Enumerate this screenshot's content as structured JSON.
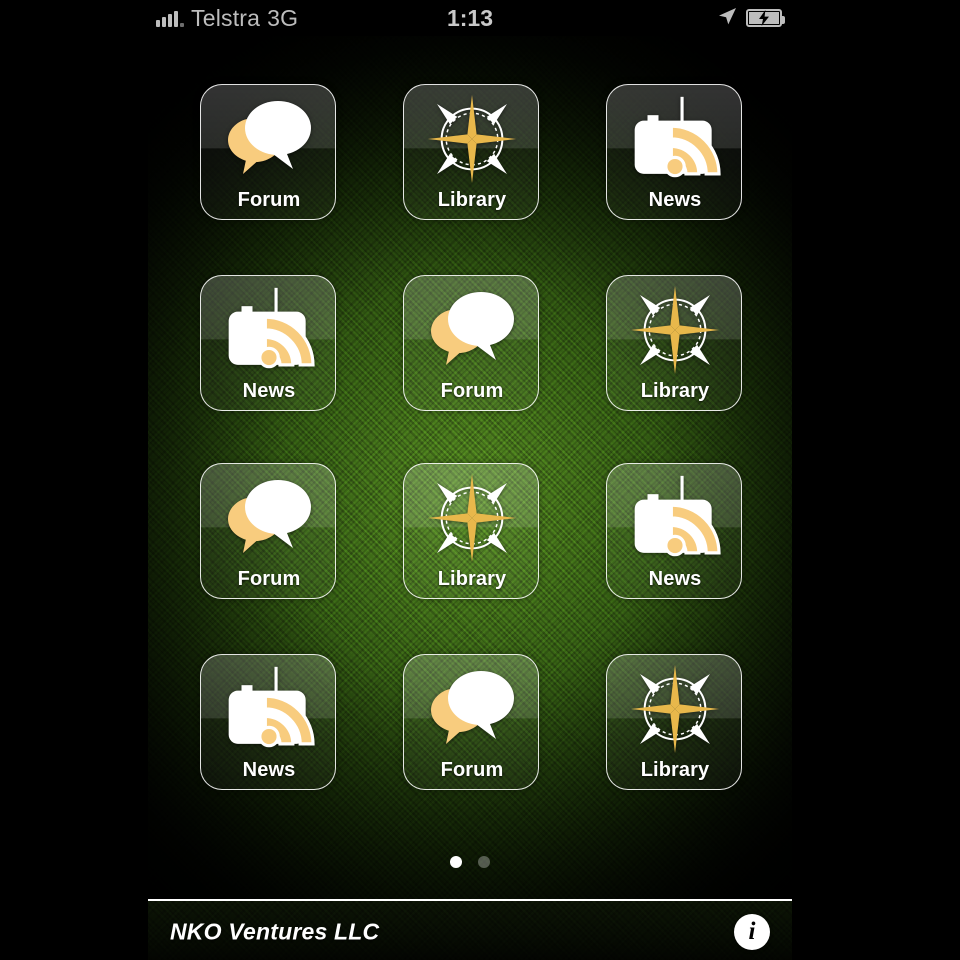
{
  "statusbar": {
    "carrier": "Telstra",
    "network": "3G",
    "time": "1:13",
    "signal_icon": "signal-bars-icon",
    "location_icon": "location-arrow-icon",
    "battery_icon": "battery-charging-icon",
    "text_color": "#bdbdbd"
  },
  "colors": {
    "accent_orange": "#f8cc7e",
    "accent_gold": "#e8b84b",
    "tile_border": "#ffffff",
    "background_green": "#56912a",
    "footer_black": "#070c03"
  },
  "grid": {
    "columns": 3,
    "rows": 4,
    "apps": [
      {
        "label": "Forum",
        "icon": "speech-bubbles-icon"
      },
      {
        "label": "Library",
        "icon": "compass-rose-icon"
      },
      {
        "label": "News",
        "icon": "radio-rss-icon"
      },
      {
        "label": "News",
        "icon": "radio-rss-icon"
      },
      {
        "label": "Forum",
        "icon": "speech-bubbles-icon"
      },
      {
        "label": "Library",
        "icon": "compass-rose-icon"
      },
      {
        "label": "Forum",
        "icon": "speech-bubbles-icon"
      },
      {
        "label": "Library",
        "icon": "compass-rose-icon"
      },
      {
        "label": "News",
        "icon": "radio-rss-icon"
      },
      {
        "label": "News",
        "icon": "radio-rss-icon"
      },
      {
        "label": "Forum",
        "icon": "speech-bubbles-icon"
      },
      {
        "label": "Library",
        "icon": "compass-rose-icon"
      }
    ]
  },
  "pager": {
    "total_pages": 2,
    "current_page": 1
  },
  "footer": {
    "brand": "NKO Ventures LLC",
    "info_label": "i",
    "info_icon": "info-circle-icon"
  }
}
